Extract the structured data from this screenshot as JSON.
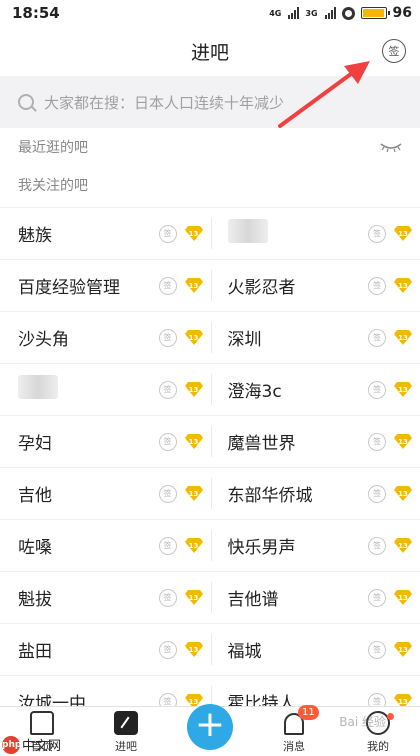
{
  "status": {
    "time": "18:54",
    "net1": "4G",
    "net2": "3G",
    "battery": "96",
    "battery_level": 0.96
  },
  "nav": {
    "title": "进吧",
    "sign_icon_label": "签"
  },
  "search": {
    "placeholder": "大家都在搜：日本人口连续十年减少"
  },
  "sections": {
    "recent": "最近逛的吧",
    "followed": "我关注的吧"
  },
  "badge": {
    "sign": "签",
    "level": "13",
    "level_color": "#f5b800"
  },
  "forums": [
    [
      "魅族",
      ""
    ],
    [
      "百度经验管理",
      "火影忍者"
    ],
    [
      "沙头角",
      "深圳"
    ],
    [
      "",
      "澄海3c"
    ],
    [
      "孕妇",
      "魔兽世界"
    ],
    [
      "吉他",
      "东部华侨城"
    ],
    [
      "咗嗓",
      "快乐男声"
    ],
    [
      "魁拔",
      "吉他谱"
    ],
    [
      "盐田",
      "福城"
    ],
    [
      "汝城一中",
      "霍比特人"
    ]
  ],
  "tabs": {
    "home": "首页",
    "enter": "进吧",
    "messages": "消息",
    "message_count": "11",
    "me": "我的"
  },
  "watermarks": {
    "left_logo": "php",
    "left_text": "中文网",
    "right_text": "Bai 经验"
  },
  "colors": {
    "accent": "#2fa8e6",
    "alert": "#ff5a3c",
    "arrow": "#f04040"
  }
}
